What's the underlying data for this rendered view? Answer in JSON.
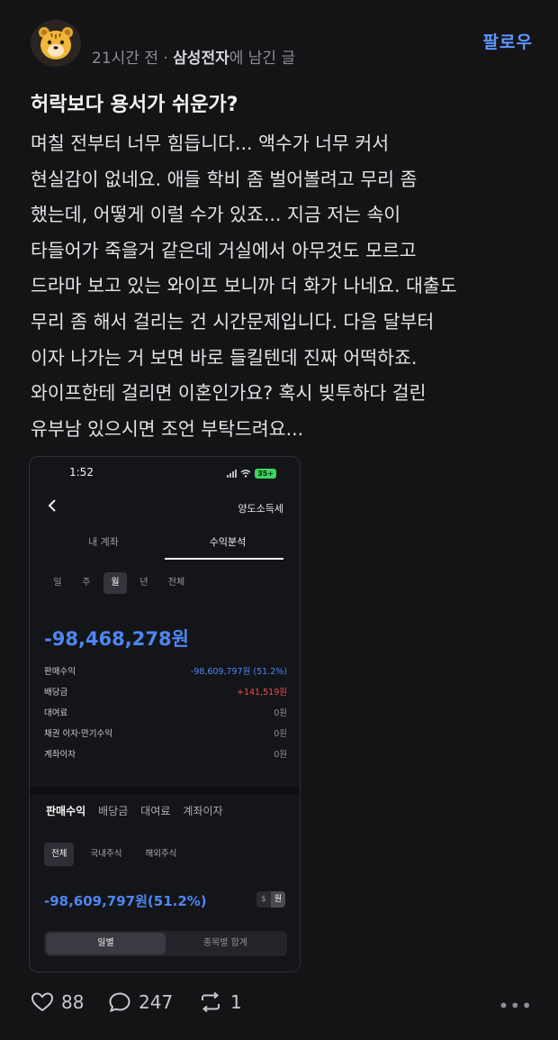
{
  "post": {
    "meta_time": "21시간 전 · ",
    "meta_board": "삼성전자",
    "meta_suffix": "에 남긴 글",
    "follow_label": "팔로우",
    "title": "허락보다 용서가 쉬운가?",
    "body_lines": [
      "며칠 전부터 너무 힘듭니다... 액수가 너무 커서",
      "현실감이 없네요. 애들 학비 좀 벌어볼려고 무리 좀",
      "했는데, 어떻게 이럴 수가 있죠... 지금 저는 속이",
      "타들어가 죽을거 같은데 거실에서 아무것도 모르고",
      "드라마 보고 있는 와이프 보니까 더 화가 나네요. 대출도",
      "무리 좀 해서 걸리는 건 시간문제입니다. 다음 달부터",
      "이자 나가는 거 보면 바로 들킬텐데 진짜 어떡하죠.",
      "와이프한테 걸리면 이혼인가요? 혹시 빚투하다 걸린",
      "유부남 있으시면 조언 부탁드려요..."
    ]
  },
  "screenshot": {
    "status_time": "1:52",
    "battery": "35+",
    "nav_title": "양도소득세",
    "tabs": [
      "내 계좌",
      "수익분석"
    ],
    "periods": [
      "일",
      "주",
      "월",
      "년",
      "전체"
    ],
    "active_period": "월",
    "total_amount": "-98,468,278원",
    "rows": [
      {
        "label": "판매수익",
        "value": "-98,609,797원 (51.2%)"
      },
      {
        "label": "배당금",
        "value": "+141,519원"
      },
      {
        "label": "대여료",
        "value": "0원"
      },
      {
        "label": "채권 이자·만기수익",
        "value": "0원"
      },
      {
        "label": "계좌이자",
        "value": "0원"
      }
    ],
    "subtabs": [
      "판매수익",
      "배당금",
      "대여료",
      "계좌이자"
    ],
    "chips": [
      "전체",
      "국내주식",
      "해외주식"
    ],
    "sub_amount": "-98,609,797원(51.2%)",
    "currency_toggle": [
      "$",
      "원"
    ],
    "segments": [
      "일별",
      "종목별 합계"
    ]
  },
  "actions": {
    "likes": "88",
    "comments": "247",
    "reposts": "1",
    "more": "•••"
  },
  "colors": {
    "background": "#141417",
    "accent_blue": "#5e96ff",
    "loss_blue": "#4e86f2",
    "gain_red": "#ef4b4b"
  },
  "icons": [
    "tiger-avatar-icon",
    "back-chevron-icon",
    "wifi-icon",
    "signal-icon",
    "heart-icon",
    "comment-icon",
    "repost-icon",
    "more-icon"
  ]
}
